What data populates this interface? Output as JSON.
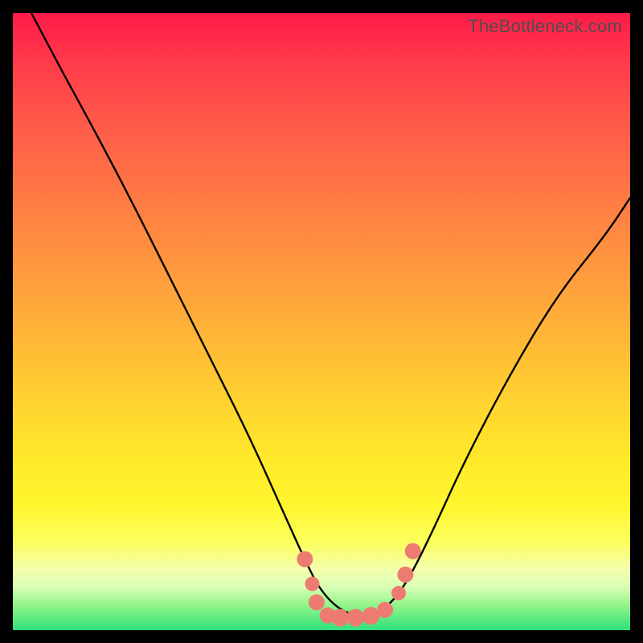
{
  "watermark": "TheBottleneck.com",
  "chart_data": {
    "type": "line",
    "title": "",
    "xlabel": "",
    "ylabel": "",
    "xlim": [
      0,
      1
    ],
    "ylim": [
      0,
      1
    ],
    "series": [
      {
        "name": "bottleneck-curve",
        "x": [
          0.03,
          0.08,
          0.14,
          0.2,
          0.26,
          0.32,
          0.38,
          0.43,
          0.47,
          0.5,
          0.54,
          0.58,
          0.61,
          0.64,
          0.68,
          0.73,
          0.8,
          0.88,
          0.96,
          1.0
        ],
        "values": [
          1.0,
          0.905,
          0.795,
          0.68,
          0.56,
          0.44,
          0.32,
          0.21,
          0.12,
          0.06,
          0.025,
          0.025,
          0.04,
          0.08,
          0.16,
          0.27,
          0.405,
          0.54,
          0.64,
          0.7
        ]
      }
    ],
    "markers": {
      "name": "highlight-dots",
      "color": "#ee7b72",
      "points": [
        {
          "x": 0.473,
          "y": 0.115,
          "r": 10
        },
        {
          "x": 0.485,
          "y": 0.075,
          "r": 9
        },
        {
          "x": 0.492,
          "y": 0.045,
          "r": 10
        },
        {
          "x": 0.51,
          "y": 0.024,
          "r": 10
        },
        {
          "x": 0.53,
          "y": 0.02,
          "r": 11
        },
        {
          "x": 0.555,
          "y": 0.02,
          "r": 11
        },
        {
          "x": 0.58,
          "y": 0.023,
          "r": 11
        },
        {
          "x": 0.603,
          "y": 0.033,
          "r": 10
        },
        {
          "x": 0.625,
          "y": 0.06,
          "r": 9
        },
        {
          "x": 0.636,
          "y": 0.09,
          "r": 10
        },
        {
          "x": 0.648,
          "y": 0.128,
          "r": 10
        }
      ]
    },
    "annotations": []
  }
}
